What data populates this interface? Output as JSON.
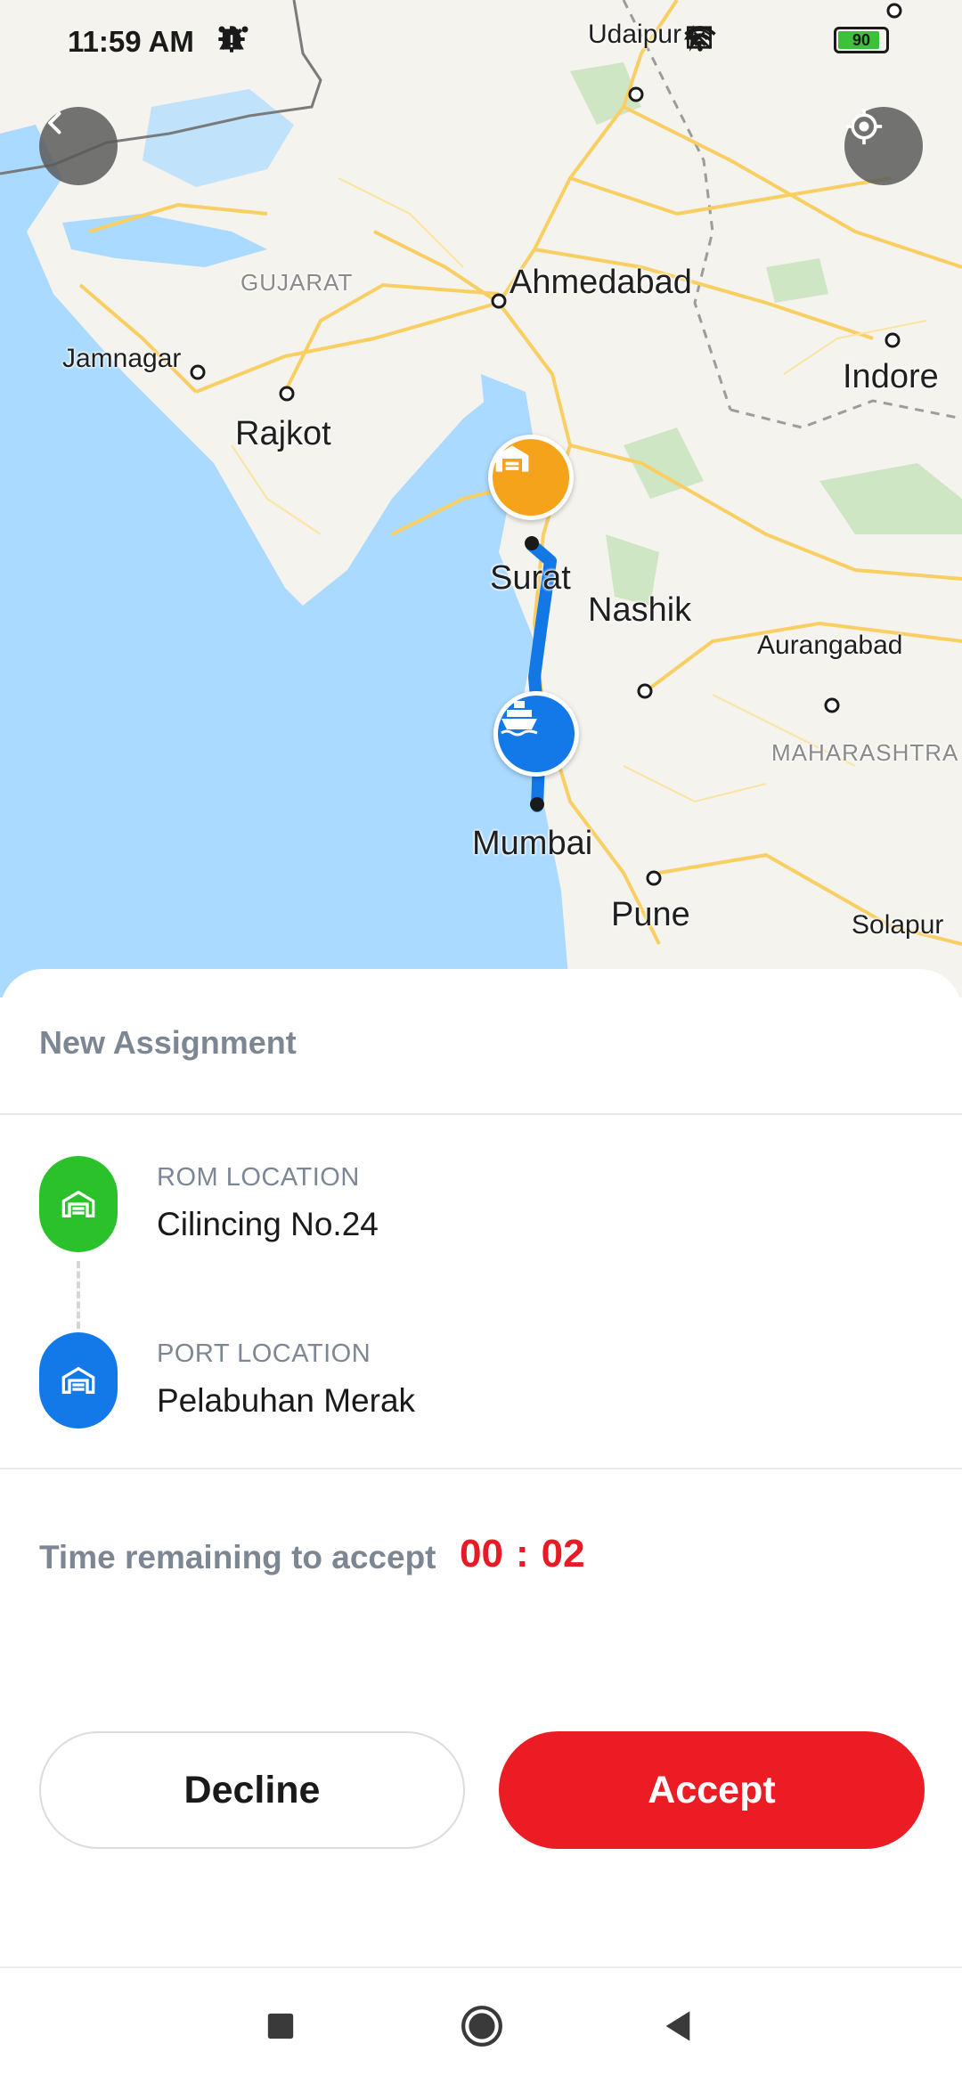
{
  "status_bar": {
    "time": "11:59 AM",
    "battery_level": "90",
    "battery_fraction": 0.9,
    "icons_left": [
      "settings-icon",
      "trash-icon",
      "warning-icon",
      "more-icon"
    ],
    "icons_right": [
      "wifi-off-icon",
      "sim-off-icon",
      "wifi-icon",
      "battery-icon",
      "charging-icon"
    ]
  },
  "map": {
    "places": {
      "udaipur": "Udaipur",
      "gujarat": "GUJARAT",
      "ahmedabad": "Ahmedabad",
      "jamnagar": "Jamnagar",
      "indore": "Indore",
      "rajkot": "Rajkot",
      "surat": "Surat",
      "nashik": "Nashik",
      "aurangabad": "Aurangabad",
      "maharashtra": "MAHARASHTRA",
      "mumbai": "Mumbai",
      "pune": "Pune",
      "solapur": "Solapur"
    },
    "colors": {
      "water": "#aadaff",
      "land": "#f5f3ee",
      "roads": "#f9cf63",
      "route": "#1477e6",
      "rom_marker": "#f5a31a",
      "port_marker": "#1479e8"
    }
  },
  "assignment": {
    "title": "New Assignment",
    "rom": {
      "label": "ROM LOCATION",
      "value": "Cilincing No.24",
      "icon": "warehouse-icon",
      "color": "#2bc12b"
    },
    "port": {
      "label": "PORT LOCATION",
      "value": "Pelabuhan Merak",
      "icon": "warehouse-icon",
      "color": "#1479e8"
    },
    "timer_label": "Time remaining to accept",
    "timer_minutes": "00",
    "timer_separator": ":",
    "timer_seconds": "02",
    "decline_label": "Decline",
    "accept_label": "Accept",
    "accent_color": "#ec1c24"
  },
  "navbar": {
    "icons": [
      "recent-apps-icon",
      "home-icon",
      "back-icon"
    ]
  }
}
